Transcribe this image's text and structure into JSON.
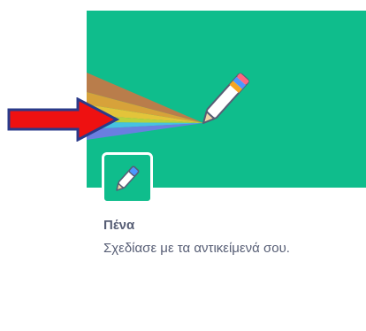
{
  "extension": {
    "title": "Πένα",
    "description": "Σχεδίασε με τα αντικείμενά σου.",
    "icon": "pen-icon",
    "banner_icon": "rainbow-pen-illustration",
    "colors": {
      "banner_background": "#0fbd8c",
      "text": "#575e75",
      "badge_border": "#ffffff"
    }
  },
  "annotation": {
    "icon": "red-arrow-icon",
    "color": "#ee1111",
    "outline": "#2a3a8a"
  }
}
